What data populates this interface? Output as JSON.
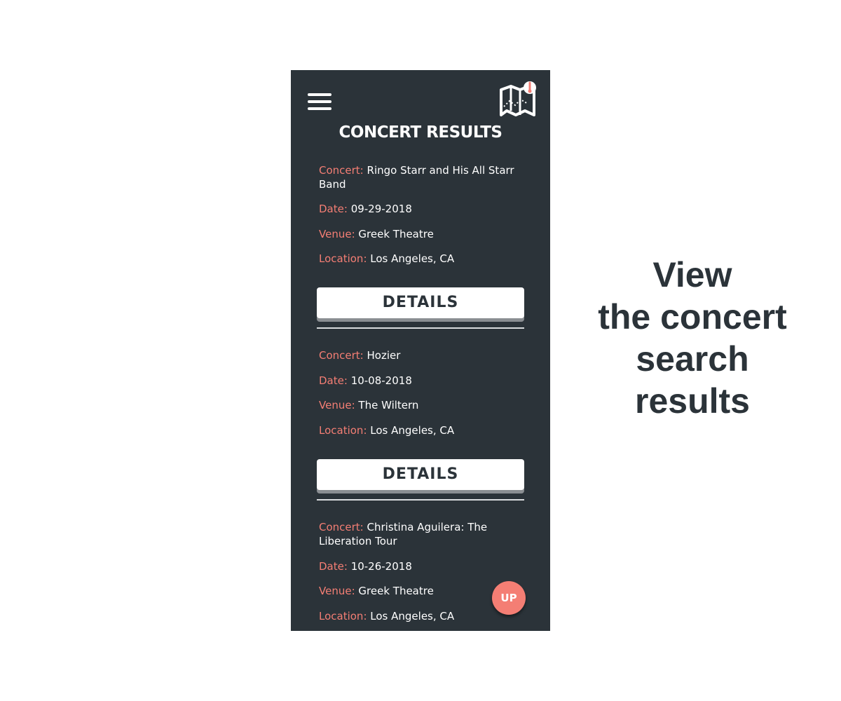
{
  "app": {
    "title": "CONCERT RESULTS",
    "menu_icon": "hamburger-menu-icon",
    "logo_icon": "map-pin-logo-icon"
  },
  "labels": {
    "concert": "Concert:",
    "date": "Date:",
    "venue": "Venue:",
    "location": "Location:",
    "details": "DETAILS",
    "up": "UP"
  },
  "results": [
    {
      "concert": "Ringo Starr and His All Starr Band",
      "date": "09-29-2018",
      "venue": "Greek Theatre",
      "location": "Los Angeles, CA"
    },
    {
      "concert": "Hozier",
      "date": "10-08-2018",
      "venue": "The Wiltern",
      "location": "Los Angeles, CA"
    },
    {
      "concert": "Christina Aguilera: The Liberation Tour",
      "date": "10-26-2018",
      "venue": "Greek Theatre",
      "location": "Los Angeles, CA"
    }
  ],
  "caption": {
    "line1": "View",
    "line2": "the concert",
    "line3": "search",
    "line4": "results"
  },
  "colors": {
    "background": "#2b3339",
    "accent": "#f47e74",
    "text": "#ffffff"
  }
}
